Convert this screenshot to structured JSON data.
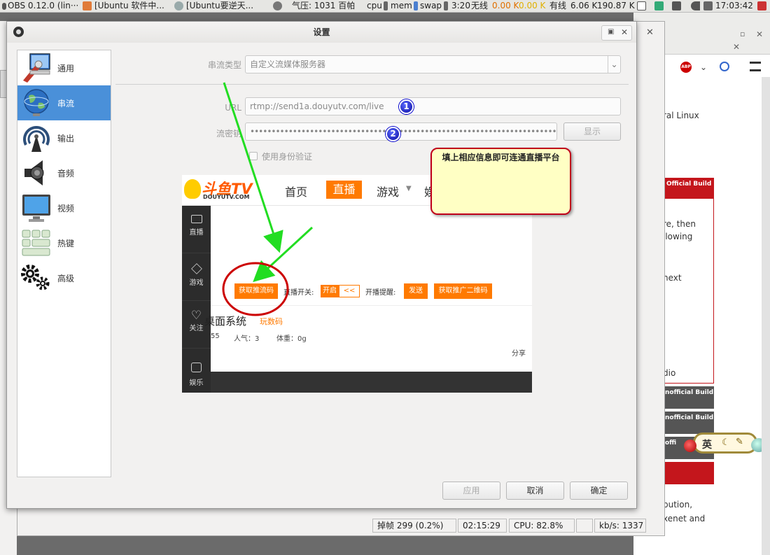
{
  "top_panel": {
    "items": [
      "OBS 0.12.0 (lin···",
      "[Ubuntu 软件中...",
      "[Ubuntu要逆天...",
      "气压: 1031 百帕",
      "cpu",
      "mem",
      "swap",
      "3:20",
      "无线",
      "0.00 K",
      "0.00 K",
      "有线",
      "6.06 K",
      "190.87 K",
      "17:03:42"
    ]
  },
  "background": {
    "right_texts": [
      "ral Linux",
      "Official Build",
      "re, then",
      "llowing",
      "next",
      "dio",
      "nofficial Build",
      "nofficial Build",
      "offi",
      "bution,",
      "xenet and"
    ],
    "ime": "英"
  },
  "dialog": {
    "title": "设置",
    "sidebar": [
      {
        "label": "通用",
        "icon": "general-icon"
      },
      {
        "label": "串流",
        "icon": "stream-globe-icon"
      },
      {
        "label": "输出",
        "icon": "output-icon"
      },
      {
        "label": "音频",
        "icon": "speaker-icon"
      },
      {
        "label": "视频",
        "icon": "monitor-icon"
      },
      {
        "label": "热键",
        "icon": "keyboard-icon"
      },
      {
        "label": "高级",
        "icon": "gears-icon"
      }
    ],
    "active_item": "串流",
    "stream_type_label": "串流类型",
    "stream_type_value": "自定义流媒体服务器",
    "url_label": "URL",
    "url_value": "rtmp://send1a.douyutv.com/live",
    "key_label": "流密钥",
    "key_value": "••••••••••••••••••••••••••••••••••••••••••••••••••••••••••••••••••••••••••••",
    "show_button": "显示",
    "auth_checkbox": "使用身份验证",
    "apply": "应用",
    "cancel": "取消",
    "ok": "确定"
  },
  "annotations": {
    "badge1": "1",
    "badge2": "2",
    "note": "填上相应信息即可连通直播平台"
  },
  "douyu": {
    "logo_main": "斗鱼TV",
    "logo_sub": "DOUYUTV.COM",
    "nav": [
      "首页",
      "直播",
      "游戏",
      "娱"
    ],
    "nav_active": "直播",
    "side": [
      "直播",
      "游戏",
      "关注",
      "娱乐"
    ],
    "get_push_code": "获取推流码",
    "live_switch_label": "直播开关:",
    "live_switch_on": "开启",
    "live_switch_arrow": "<<",
    "notify_label": "开播提醒:",
    "send_button": "发送",
    "qr_button": "获取推广二维码",
    "room_title": "桌面系统",
    "room_link": "玩数码",
    "stat_id": "55",
    "stat_pop": "人气：3",
    "stat_weight": "体重：0g",
    "share": "分享"
  },
  "statusbar": {
    "dropped": "掉帧 299 (0.2%)",
    "time": "02:15:29",
    "cpu": "CPU: 82.8%",
    "kbs": "kb/s: 1337"
  }
}
